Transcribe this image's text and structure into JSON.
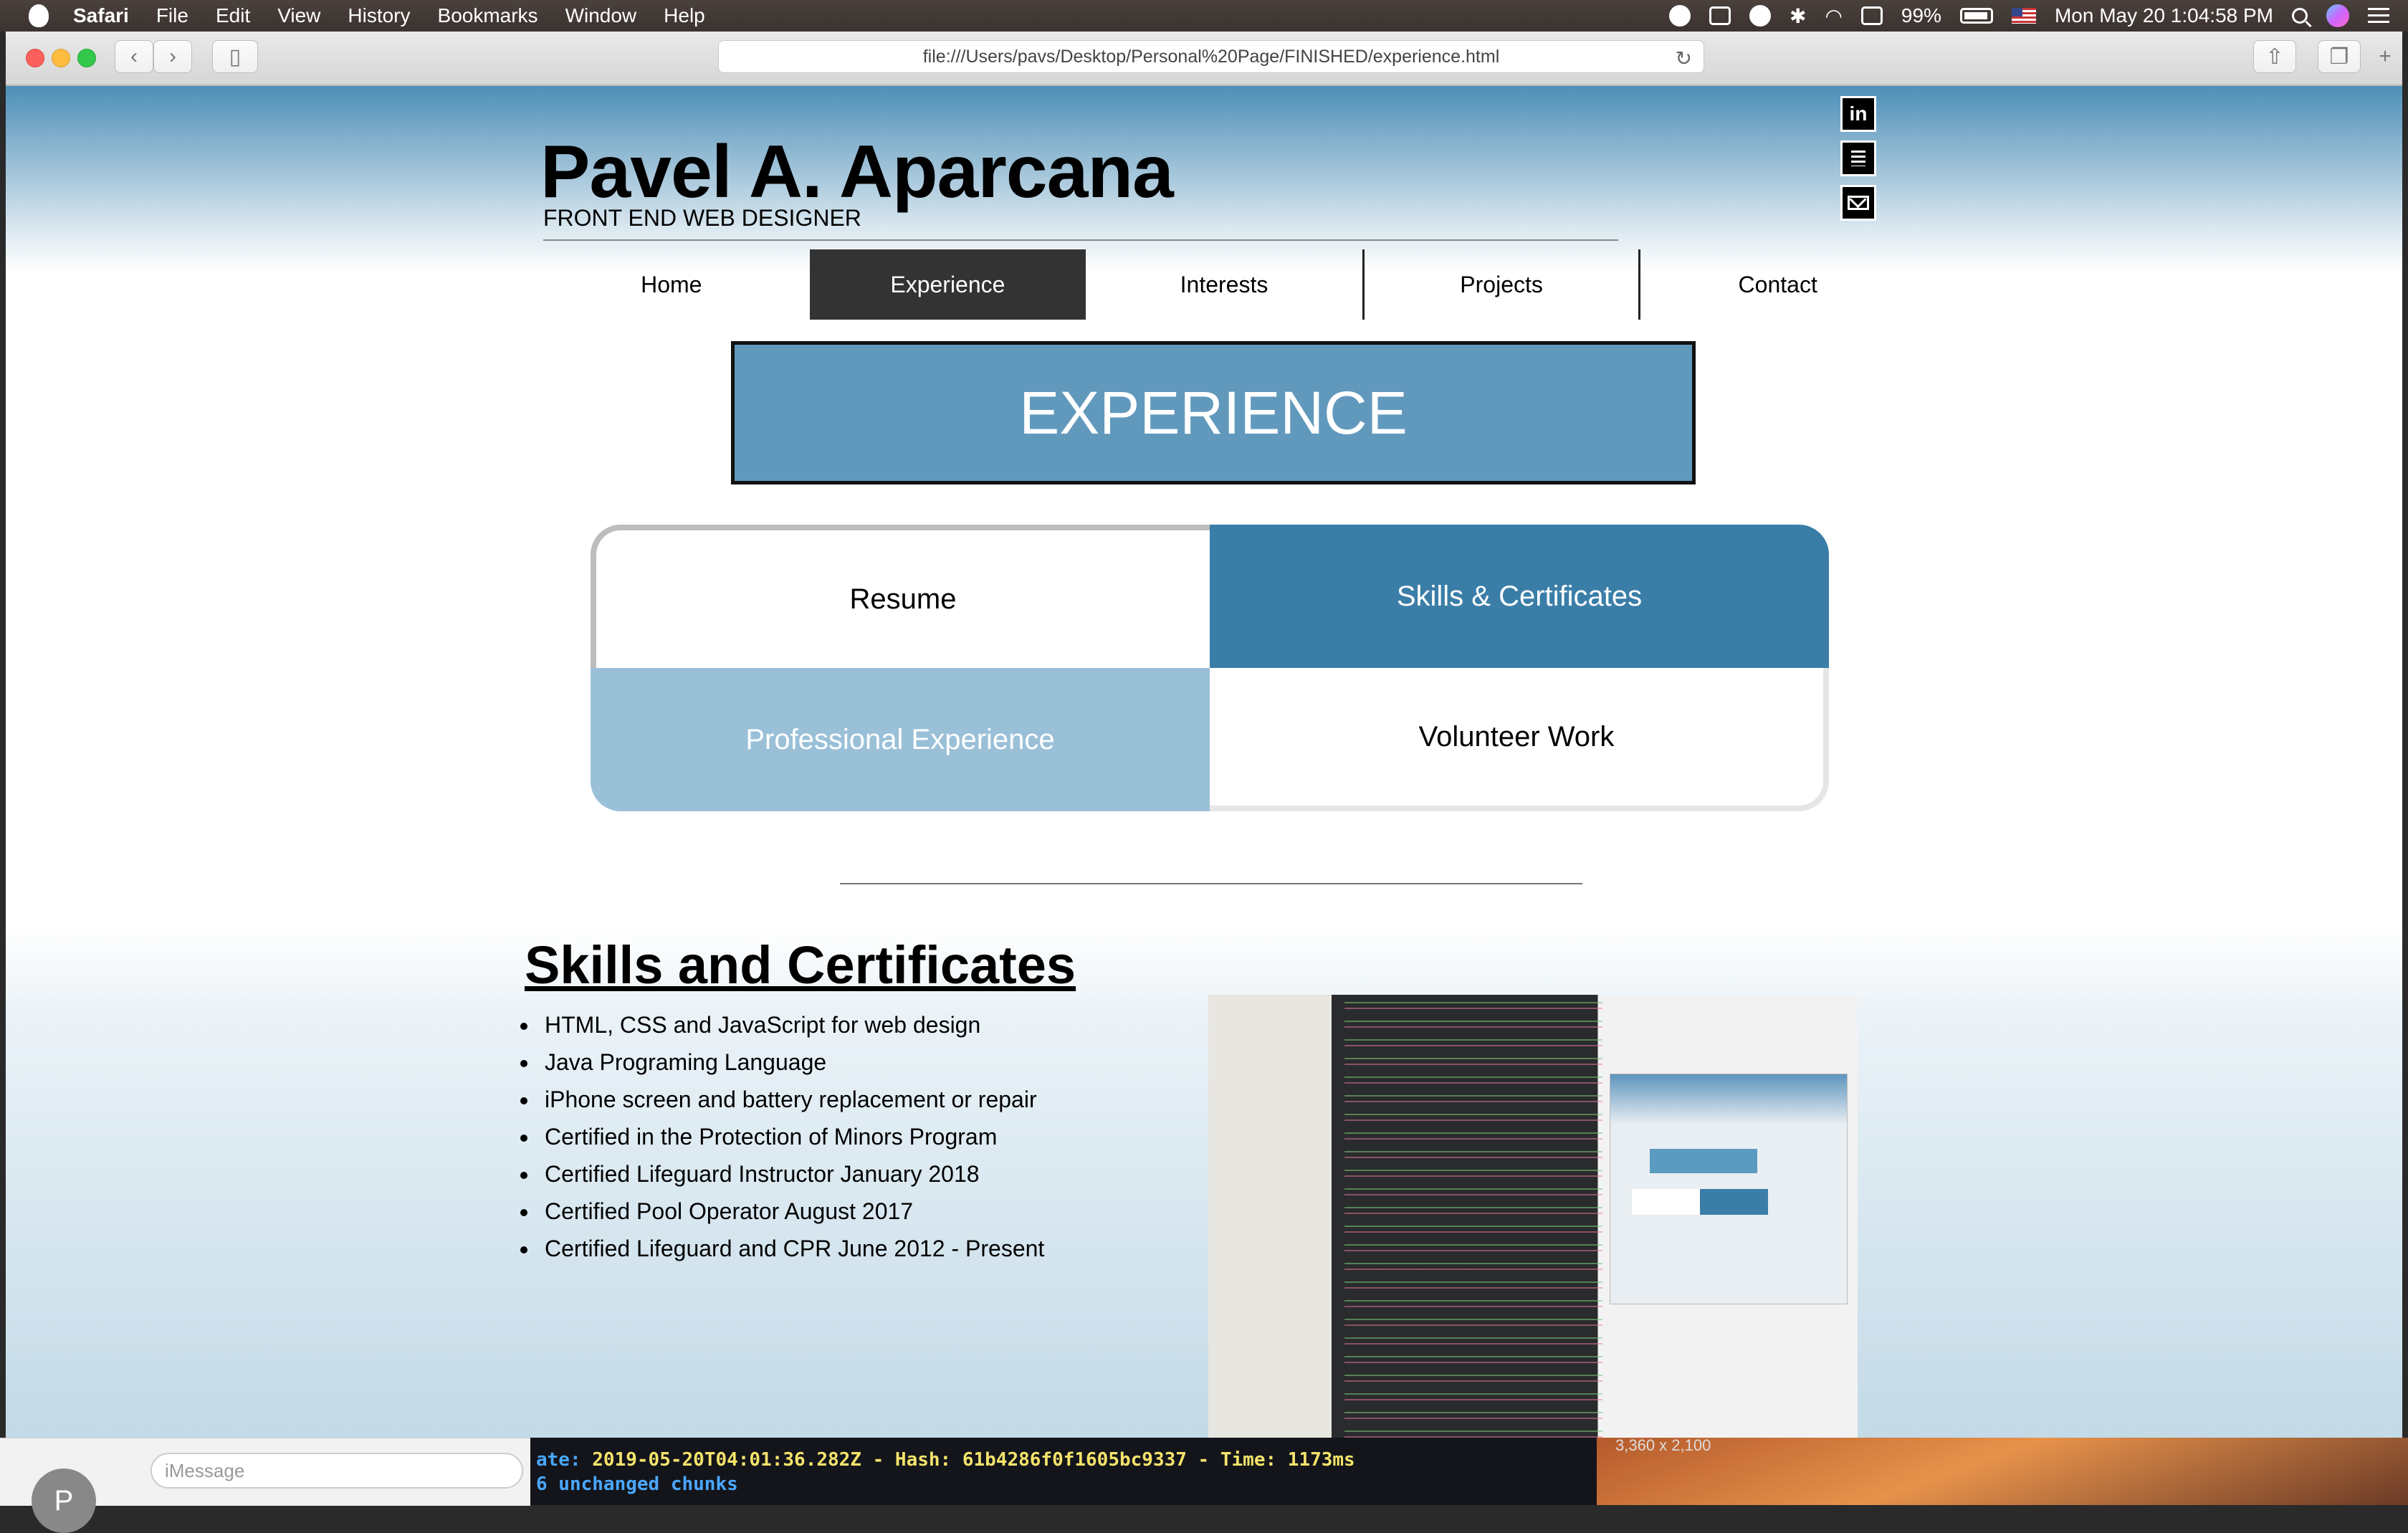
{
  "menubar": {
    "app": "Safari",
    "items": [
      "File",
      "Edit",
      "View",
      "History",
      "Bookmarks",
      "Window",
      "Help"
    ],
    "battery": "99%",
    "clock": "Mon May 20  1:04:58 PM"
  },
  "browser": {
    "url": "file:///Users/pavs/Desktop/Personal%20Page/FINISHED/experience.html"
  },
  "site": {
    "name": "Pavel A. Aparcana",
    "tagline": "FRONT END WEB DESIGNER",
    "social": [
      "linkedin-icon",
      "document-icon",
      "mail-icon"
    ],
    "nav": [
      "Home",
      "Experience",
      "Interests",
      "Projects",
      "Contact"
    ],
    "active_nav": "Experience",
    "banner": "EXPERIENCE",
    "grid": {
      "resume": "Resume",
      "skills": "Skills & Certificates",
      "professional": "Professional Experience",
      "volunteer": "Volunteer Work"
    },
    "section_title": "Skills and Certificates",
    "skills": [
      "HTML, CSS and JavaScript for web design",
      "Java Programing Language",
      "iPhone screen and battery replacement or repair",
      "Certified in the Protection of Minors Program",
      "Certified Lifeguard Instructor January 2018",
      "Certified Pool Operator August 2017",
      "Certified Lifeguard and CPR June 2012 - Present"
    ]
  },
  "desktop": {
    "imessage_placeholder": "iMessage",
    "avatar_initial": "P",
    "terminal_line1_prefix": "ate: ",
    "terminal_line1_value": "2019-05-20T04:01:36.282Z - Hash: 61b4286f0f1605bc9337 - Time: 1173ms",
    "terminal_line2": "6 unchanged chunks",
    "wallpaper_label": "3,360 x 2,100"
  },
  "colors": {
    "banner": "#6199bd",
    "skills_tile": "#3a7ea8",
    "professional_tile": "#9ac0d8",
    "active_nav": "#333333"
  }
}
